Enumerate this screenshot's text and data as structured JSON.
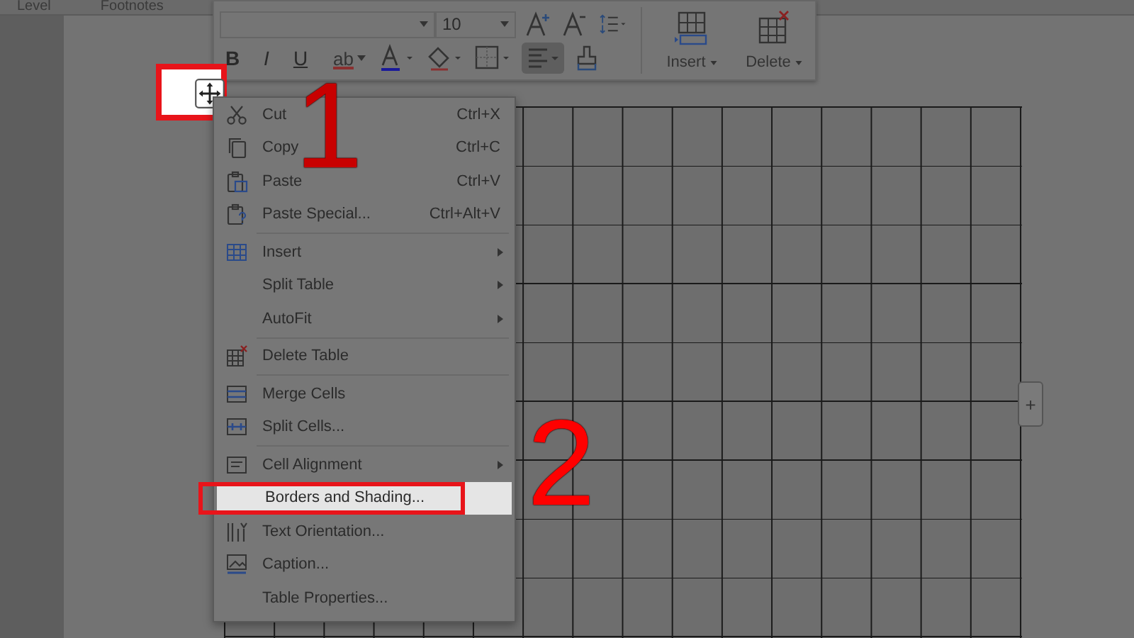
{
  "ribbon_tabs": [
    "Level",
    "Footnotes"
  ],
  "toolbar": {
    "font_size": {
      "value": "10"
    },
    "highlight_label": "ab",
    "format_buttons": [
      {
        "label": "B",
        "kind": "bold",
        "selected": false
      },
      {
        "label": "I",
        "kind": "italic",
        "selected": false
      },
      {
        "label": "U",
        "kind": "underline",
        "selected": false
      }
    ],
    "align_selected": true,
    "big_buttons": [
      {
        "label": "Insert",
        "kind": "insert"
      },
      {
        "label": "Delete",
        "kind": "delete"
      }
    ]
  },
  "annotations": [
    {
      "label": "1"
    },
    {
      "label": "2"
    }
  ],
  "context_menu": {
    "groups": [
      [
        {
          "label": "Cut",
          "shortcut": "Ctrl+X",
          "icon": true,
          "submenu": false,
          "selected": false
        },
        {
          "label": "Copy",
          "shortcut": "Ctrl+C",
          "icon": true,
          "submenu": false,
          "selected": false
        },
        {
          "label": "Paste",
          "shortcut": "Ctrl+V",
          "icon": true,
          "submenu": false,
          "selected": false
        },
        {
          "label": "Paste Special...",
          "shortcut": "Ctrl+Alt+V",
          "icon": true,
          "submenu": false,
          "selected": false
        }
      ],
      [
        {
          "label": "Insert",
          "icon": true,
          "submenu": true,
          "selected": false
        },
        {
          "label": "Split Table",
          "icon": false,
          "submenu": true,
          "selected": false
        },
        {
          "label": "AutoFit",
          "icon": false,
          "submenu": true,
          "selected": false
        }
      ],
      [
        {
          "label": "Delete Table",
          "icon": true,
          "submenu": false,
          "selected": false
        }
      ],
      [
        {
          "label": "Merge Cells",
          "icon": true,
          "submenu": false,
          "selected": false
        },
        {
          "label": "Split Cells...",
          "icon": true,
          "submenu": false,
          "selected": false
        }
      ],
      [
        {
          "label": "Cell Alignment",
          "icon": true,
          "submenu": true,
          "selected": false
        },
        {
          "label": "Borders and Shading...",
          "icon": false,
          "submenu": false,
          "selected": true
        },
        {
          "label": "Text Orientation...",
          "icon": true,
          "submenu": false,
          "selected": false
        },
        {
          "label": "Caption...",
          "icon": true,
          "submenu": false,
          "selected": false
        },
        {
          "label": "Table Properties...",
          "icon": false,
          "submenu": false,
          "selected": false
        }
      ]
    ]
  },
  "add_row_button": {
    "label": "+"
  }
}
